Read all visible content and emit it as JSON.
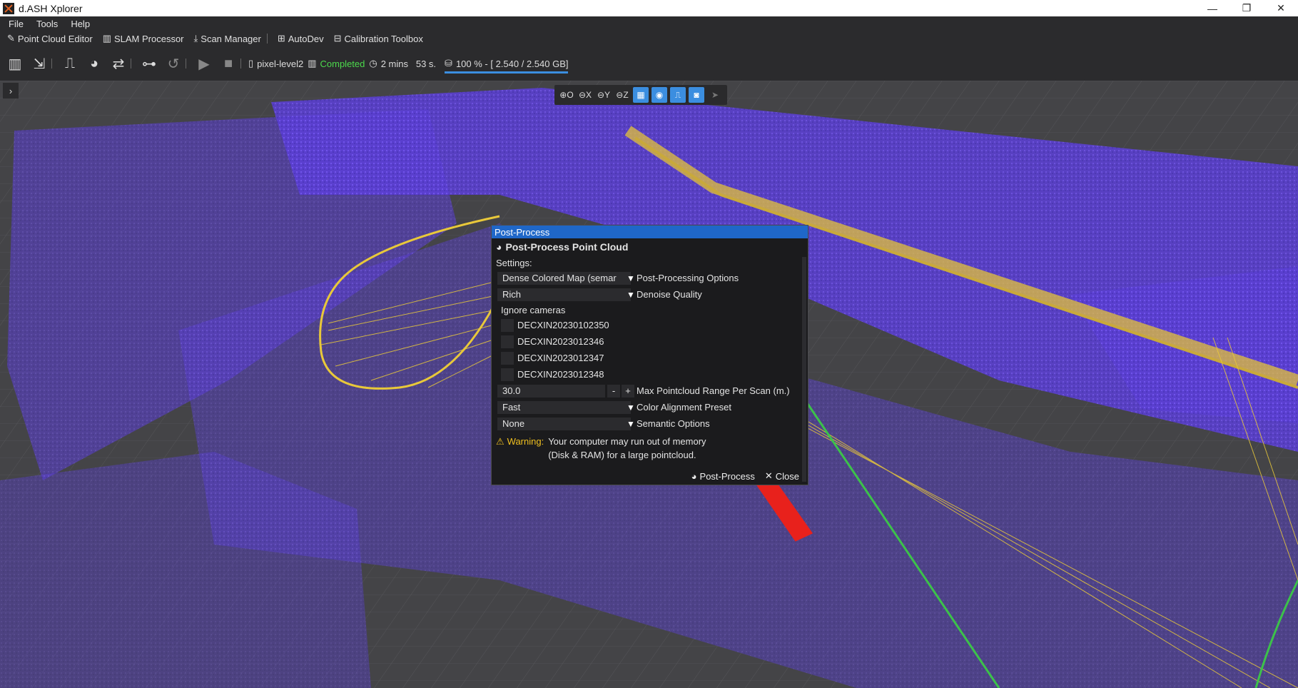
{
  "window": {
    "title": "d.ASH Xplorer",
    "controls": [
      "—",
      "❐",
      "✕"
    ]
  },
  "menu": [
    "File",
    "Tools",
    "Help"
  ],
  "tools_bar": [
    {
      "icon": "edit-icon",
      "label": "Point Cloud Editor"
    },
    {
      "icon": "map-icon",
      "label": "SLAM Processor"
    },
    {
      "icon": "download-icon",
      "label": "Scan Manager"
    },
    {
      "icon": "robot-icon",
      "label": "AutoDev"
    },
    {
      "icon": "toolbox-icon",
      "label": "Calibration Toolbox"
    }
  ],
  "toolbar": {
    "file_name": "pixel-level2",
    "status": "Completed",
    "duration": "2 mins   53 s.",
    "storage": "100 % - [ 2.540 / 2.540 GB]",
    "storage_progress": 1.0,
    "colors": {
      "status": "#4cd94c",
      "progress": "#3b8ee0"
    }
  },
  "view_toolbar": {
    "items": [
      {
        "label": "O",
        "icon": "globe-icon",
        "active": false
      },
      {
        "label": "X",
        "icon": "axis-x-icon",
        "active": false
      },
      {
        "label": "Y",
        "icon": "axis-y-icon",
        "active": false
      },
      {
        "label": "Z",
        "icon": "axis-z-icon",
        "active": false
      },
      {
        "label": "",
        "icon": "grid-icon",
        "active": true
      },
      {
        "label": "",
        "icon": "point-icon",
        "active": true
      },
      {
        "label": "",
        "icon": "trajectory-icon",
        "active": true
      },
      {
        "label": "",
        "icon": "camera-icon",
        "active": true
      },
      {
        "label": "",
        "icon": "navigate-icon",
        "active": false
      }
    ]
  },
  "dialog": {
    "window_title": "Post-Process",
    "heading": "Post-Process Point Cloud",
    "settings_label": "Settings:",
    "post_processing": {
      "value": "Dense Colored Map (semar",
      "label": "Post-Processing Options"
    },
    "denoise": {
      "value": "Rich",
      "label": "Denoise Quality"
    },
    "ignore_cameras_label": "Ignore cameras",
    "cameras": [
      {
        "name": "DECXIN20230102350",
        "checked": false
      },
      {
        "name": "DECXIN2023012346",
        "checked": false
      },
      {
        "name": "DECXIN2023012347",
        "checked": false
      },
      {
        "name": "DECXIN2023012348",
        "checked": false
      }
    ],
    "range": {
      "value": "30.0",
      "minus": "-",
      "plus": "+",
      "label": "Max Pointcloud Range Per Scan (m.)"
    },
    "color_alignment": {
      "value": "Fast",
      "label": "Color Alignment Preset"
    },
    "semantic": {
      "value": "None",
      "label": "Semantic Options"
    },
    "warning": {
      "label": "Warning:",
      "line1": "Your computer may run out of memory",
      "line2": "(Disk & RAM) for a large pointcloud."
    },
    "buttons": {
      "post_process": "Post-Process",
      "close": "Close"
    }
  }
}
